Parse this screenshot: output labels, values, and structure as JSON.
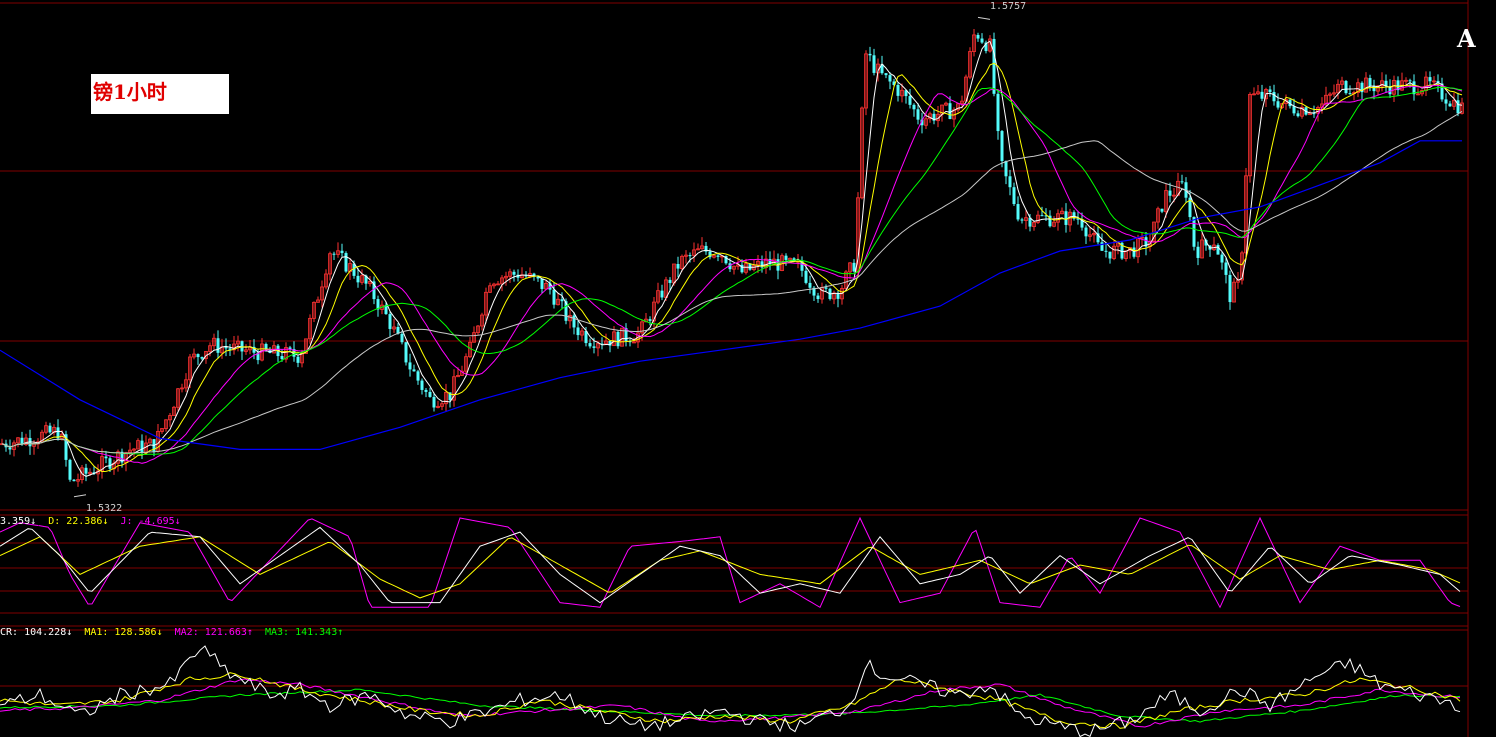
{
  "title": "镑1小时",
  "corner_label": "A",
  "price_high_label": "1.5757",
  "price_low_label": "1.5322",
  "indicators": {
    "kdj": {
      "k": {
        "label": "3.359",
        "arrow": "↓",
        "color": "#ffffff"
      },
      "d": {
        "label": "D: 22.386",
        "arrow": "↓",
        "color": "#ffff00"
      },
      "j": {
        "label": "J: -4.695",
        "arrow": "↓",
        "color": "#ff00ff"
      }
    },
    "cr": {
      "cr": {
        "label": "CR: 104.228",
        "arrow": "↓",
        "color": "#ffffff"
      },
      "ma1": {
        "label": "MA1: 128.586",
        "arrow": "↓",
        "color": "#ffff00"
      },
      "ma2": {
        "label": "MA2: 121.663",
        "arrow": "↑",
        "color": "#ff00ff"
      },
      "ma3": {
        "label": "MA3: 141.343",
        "arrow": "↑",
        "color": "#00ff00"
      }
    }
  },
  "colors": {
    "background": "#000000",
    "up_candle": "#ff3232",
    "down_candle": "#54fcfc",
    "grid": "#800000",
    "ma5": "#ffffff",
    "ma10": "#ffff00",
    "ma20": "#ff00ff",
    "ma30": "#00ff00",
    "ma60": "#c8c8c8",
    "ma120": "#0000ff"
  },
  "chart_data": {
    "type": "candlestick",
    "y_range": [
      1.531,
      1.577
    ],
    "high": 1.5757,
    "low": 1.5322,
    "price_path": [
      [
        0,
        1.537
      ],
      [
        30,
        1.5375
      ],
      [
        60,
        1.5382
      ],
      [
        70,
        1.5335
      ],
      [
        80,
        1.534
      ],
      [
        100,
        1.535
      ],
      [
        130,
        1.5365
      ],
      [
        155,
        1.537
      ],
      [
        170,
        1.54
      ],
      [
        190,
        1.5445
      ],
      [
        210,
        1.546
      ],
      [
        240,
        1.5455
      ],
      [
        270,
        1.5452
      ],
      [
        300,
        1.545
      ],
      [
        315,
        1.5495
      ],
      [
        330,
        1.5545
      ],
      [
        350,
        1.553
      ],
      [
        370,
        1.551
      ],
      [
        390,
        1.548
      ],
      [
        410,
        1.544
      ],
      [
        430,
        1.541
      ],
      [
        450,
        1.5415
      ],
      [
        470,
        1.5455
      ],
      [
        490,
        1.552
      ],
      [
        520,
        1.5525
      ],
      [
        550,
        1.551
      ],
      [
        570,
        1.548
      ],
      [
        590,
        1.5465
      ],
      [
        610,
        1.5465
      ],
      [
        640,
        1.547
      ],
      [
        660,
        1.5505
      ],
      [
        680,
        1.5535
      ],
      [
        700,
        1.5545
      ],
      [
        720,
        1.5545
      ],
      [
        740,
        1.5525
      ],
      [
        770,
        1.5535
      ],
      [
        800,
        1.553
      ],
      [
        820,
        1.5505
      ],
      [
        840,
        1.551
      ],
      [
        855,
        1.5535
      ],
      [
        865,
        1.5725
      ],
      [
        880,
        1.5705
      ],
      [
        900,
        1.569
      ],
      [
        920,
        1.5665
      ],
      [
        940,
        1.567
      ],
      [
        960,
        1.5675
      ],
      [
        975,
        1.5745
      ],
      [
        990,
        1.573
      ],
      [
        1000,
        1.5625
      ],
      [
        1020,
        1.5575
      ],
      [
        1050,
        1.5575
      ],
      [
        1080,
        1.5575
      ],
      [
        1100,
        1.5545
      ],
      [
        1130,
        1.5545
      ],
      [
        1150,
        1.5555
      ],
      [
        1165,
        1.5595
      ],
      [
        1185,
        1.5605
      ],
      [
        1195,
        1.5545
      ],
      [
        1215,
        1.5555
      ],
      [
        1230,
        1.5505
      ],
      [
        1240,
        1.5515
      ],
      [
        1250,
        1.5685
      ],
      [
        1270,
        1.5685
      ],
      [
        1290,
        1.5675
      ],
      [
        1320,
        1.5675
      ],
      [
        1340,
        1.5695
      ],
      [
        1360,
        1.5695
      ],
      [
        1400,
        1.5695
      ],
      [
        1430,
        1.5695
      ],
      [
        1462,
        1.5675
      ]
    ],
    "ma120_path": [
      [
        0,
        1.5455
      ],
      [
        80,
        1.541
      ],
      [
        160,
        1.5375
      ],
      [
        240,
        1.5365
      ],
      [
        320,
        1.5365
      ],
      [
        400,
        1.5385
      ],
      [
        480,
        1.541
      ],
      [
        560,
        1.543
      ],
      [
        640,
        1.5445
      ],
      [
        720,
        1.5455
      ],
      [
        800,
        1.5465
      ],
      [
        860,
        1.5475
      ],
      [
        940,
        1.5495
      ],
      [
        1000,
        1.5525
      ],
      [
        1060,
        1.5545
      ],
      [
        1130,
        1.5555
      ],
      [
        1200,
        1.5575
      ],
      [
        1260,
        1.5585
      ],
      [
        1320,
        1.5605
      ],
      [
        1380,
        1.5625
      ],
      [
        1420,
        1.5645
      ],
      [
        1462,
        1.5645
      ]
    ],
    "kdj": {
      "k_path": [
        [
          0,
          70
        ],
        [
          30,
          90
        ],
        [
          60,
          60
        ],
        [
          90,
          20
        ],
        [
          150,
          85
        ],
        [
          200,
          80
        ],
        [
          240,
          30
        ],
        [
          320,
          90
        ],
        [
          360,
          50
        ],
        [
          390,
          10
        ],
        [
          440,
          10
        ],
        [
          480,
          70
        ],
        [
          520,
          85
        ],
        [
          560,
          40
        ],
        [
          600,
          10
        ],
        [
          640,
          40
        ],
        [
          680,
          70
        ],
        [
          720,
          60
        ],
        [
          760,
          20
        ],
        [
          800,
          30
        ],
        [
          840,
          20
        ],
        [
          880,
          80
        ],
        [
          920,
          30
        ],
        [
          960,
          40
        ],
        [
          990,
          60
        ],
        [
          1020,
          20
        ],
        [
          1060,
          60
        ],
        [
          1100,
          30
        ],
        [
          1150,
          60
        ],
        [
          1190,
          80
        ],
        [
          1230,
          20
        ],
        [
          1270,
          70
        ],
        [
          1310,
          30
        ],
        [
          1350,
          60
        ],
        [
          1400,
          50
        ],
        [
          1440,
          40
        ],
        [
          1462,
          20
        ]
      ],
      "d_path": [
        [
          0,
          60
        ],
        [
          40,
          80
        ],
        [
          80,
          40
        ],
        [
          140,
          70
        ],
        [
          200,
          80
        ],
        [
          260,
          40
        ],
        [
          330,
          75
        ],
        [
          380,
          35
        ],
        [
          420,
          15
        ],
        [
          460,
          30
        ],
        [
          510,
          80
        ],
        [
          560,
          50
        ],
        [
          610,
          20
        ],
        [
          660,
          55
        ],
        [
          700,
          65
        ],
        [
          760,
          40
        ],
        [
          820,
          30
        ],
        [
          870,
          70
        ],
        [
          920,
          40
        ],
        [
          980,
          55
        ],
        [
          1030,
          30
        ],
        [
          1080,
          50
        ],
        [
          1130,
          40
        ],
        [
          1190,
          72
        ],
        [
          1240,
          35
        ],
        [
          1280,
          60
        ],
        [
          1330,
          45
        ],
        [
          1380,
          55
        ],
        [
          1430,
          45
        ],
        [
          1462,
          30
        ]
      ],
      "j_path": [
        [
          0,
          85
        ],
        [
          20,
          95
        ],
        [
          50,
          90
        ],
        [
          70,
          40
        ],
        [
          90,
          5
        ],
        [
          140,
          95
        ],
        [
          190,
          85
        ],
        [
          230,
          10
        ],
        [
          310,
          100
        ],
        [
          350,
          80
        ],
        [
          370,
          5
        ],
        [
          430,
          5
        ],
        [
          460,
          100
        ],
        [
          510,
          90
        ],
        [
          560,
          10
        ],
        [
          600,
          5
        ],
        [
          630,
          70
        ],
        [
          680,
          75
        ],
        [
          720,
          80
        ],
        [
          740,
          10
        ],
        [
          780,
          30
        ],
        [
          820,
          5
        ],
        [
          860,
          100
        ],
        [
          900,
          10
        ],
        [
          940,
          20
        ],
        [
          975,
          90
        ],
        [
          1000,
          10
        ],
        [
          1040,
          5
        ],
        [
          1070,
          60
        ],
        [
          1100,
          20
        ],
        [
          1140,
          100
        ],
        [
          1180,
          85
        ],
        [
          1220,
          5
        ],
        [
          1260,
          100
        ],
        [
          1300,
          10
        ],
        [
          1340,
          70
        ],
        [
          1380,
          55
        ],
        [
          1420,
          55
        ],
        [
          1450,
          10
        ],
        [
          1462,
          5
        ]
      ],
      "range": [
        0,
        100
      ]
    },
    "cr": {
      "cr_path": [
        [
          0,
          30
        ],
        [
          40,
          40
        ],
        [
          80,
          20
        ],
        [
          120,
          40
        ],
        [
          170,
          50
        ],
        [
          200,
          85
        ],
        [
          230,
          60
        ],
        [
          270,
          40
        ],
        [
          300,
          45
        ],
        [
          330,
          30
        ],
        [
          370,
          40
        ],
        [
          410,
          20
        ],
        [
          450,
          15
        ],
        [
          490,
          25
        ],
        [
          520,
          35
        ],
        [
          560,
          40
        ],
        [
          600,
          20
        ],
        [
          640,
          10
        ],
        [
          680,
          15
        ],
        [
          720,
          25
        ],
        [
          760,
          15
        ],
        [
          800,
          10
        ],
        [
          850,
          30
        ],
        [
          865,
          70
        ],
        [
          880,
          60
        ],
        [
          920,
          50
        ],
        [
          960,
          40
        ],
        [
          990,
          50
        ],
        [
          1020,
          20
        ],
        [
          1060,
          10
        ],
        [
          1090,
          5
        ],
        [
          1130,
          15
        ],
        [
          1170,
          40
        ],
        [
          1200,
          25
        ],
        [
          1240,
          45
        ],
        [
          1270,
          30
        ],
        [
          1320,
          60
        ],
        [
          1350,
          70
        ],
        [
          1380,
          50
        ],
        [
          1420,
          40
        ],
        [
          1462,
          30
        ]
      ],
      "ma1_path": [
        [
          0,
          35
        ],
        [
          60,
          30
        ],
        [
          120,
          35
        ],
        [
          190,
          55
        ],
        [
          240,
          60
        ],
        [
          300,
          45
        ],
        [
          360,
          35
        ],
        [
          420,
          25
        ],
        [
          480,
          20
        ],
        [
          540,
          35
        ],
        [
          600,
          25
        ],
        [
          660,
          15
        ],
        [
          720,
          20
        ],
        [
          790,
          15
        ],
        [
          850,
          30
        ],
        [
          900,
          55
        ],
        [
          950,
          45
        ],
        [
          1000,
          35
        ],
        [
          1060,
          15
        ],
        [
          1120,
          10
        ],
        [
          1180,
          25
        ],
        [
          1240,
          35
        ],
        [
          1300,
          40
        ],
        [
          1360,
          55
        ],
        [
          1420,
          45
        ],
        [
          1462,
          35
        ]
      ],
      "ma2_path": [
        [
          0,
          25
        ],
        [
          80,
          28
        ],
        [
          160,
          35
        ],
        [
          240,
          55
        ],
        [
          300,
          50
        ],
        [
          380,
          35
        ],
        [
          460,
          20
        ],
        [
          540,
          25
        ],
        [
          620,
          30
        ],
        [
          700,
          15
        ],
        [
          780,
          18
        ],
        [
          860,
          25
        ],
        [
          940,
          45
        ],
        [
          1000,
          50
        ],
        [
          1060,
          30
        ],
        [
          1140,
          10
        ],
        [
          1220,
          25
        ],
        [
          1300,
          30
        ],
        [
          1380,
          45
        ],
        [
          1430,
          40
        ],
        [
          1462,
          38
        ]
      ],
      "ma3_path": [
        [
          0,
          28
        ],
        [
          120,
          30
        ],
        [
          240,
          40
        ],
        [
          360,
          45
        ],
        [
          480,
          30
        ],
        [
          600,
          25
        ],
        [
          720,
          20
        ],
        [
          840,
          22
        ],
        [
          960,
          30
        ],
        [
          1040,
          40
        ],
        [
          1120,
          20
        ],
        [
          1200,
          15
        ],
        [
          1300,
          25
        ],
        [
          1400,
          40
        ],
        [
          1462,
          38
        ]
      ],
      "range": [
        0,
        100
      ]
    }
  }
}
